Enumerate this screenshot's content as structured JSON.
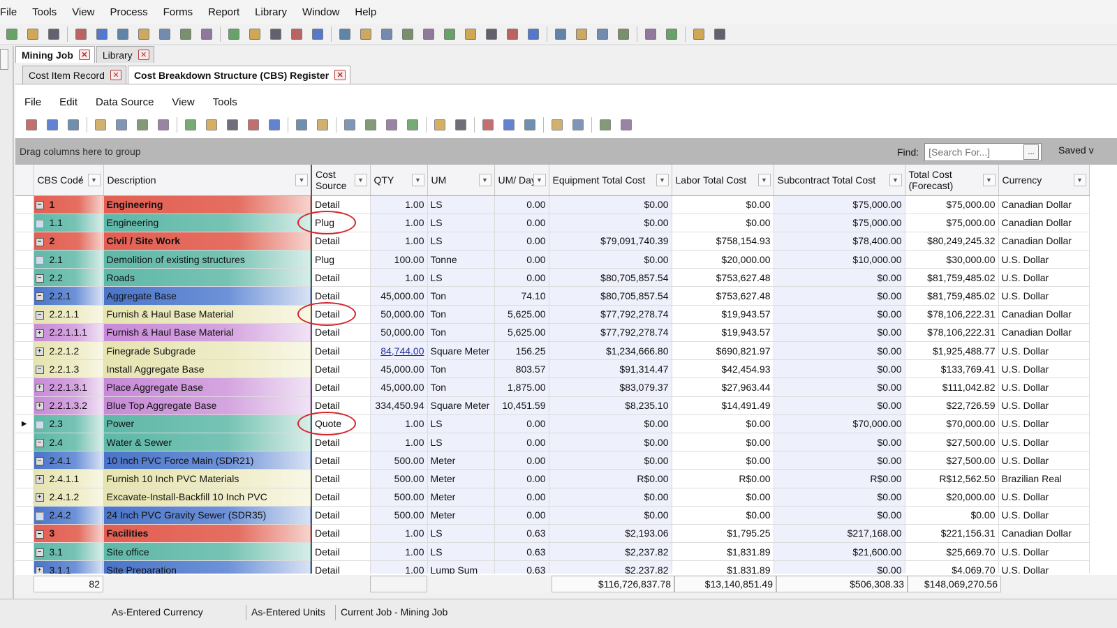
{
  "menu": [
    "File",
    "Tools",
    "View",
    "Process",
    "Forms",
    "Report",
    "Library",
    "Window",
    "Help"
  ],
  "toolbar_icons": [
    "new-icon",
    "open-icon",
    "save-icon",
    "delete-icon",
    "triangle-icon",
    "copy-icon",
    "folder-icon",
    "user-edit-icon",
    "hierarchy-icon",
    "group-icon",
    "document-icon",
    "print-icon",
    "mail-icon",
    "comment-icon",
    "approve-icon",
    "filter-icon",
    "chart-icon",
    "export-icon",
    "clipboard-icon",
    "target-icon",
    "crosshair-icon",
    "money-icon",
    "gear-icon",
    "disabled-icon",
    "bar-chart-icon",
    "pie-icon",
    "book-icon",
    "excel-icon",
    "paperclip-icon",
    "add-icon",
    "calculator-icon",
    "person-icon",
    "help-icon"
  ],
  "tabs1": [
    {
      "label": "Mining Job",
      "active": true
    },
    {
      "label": "Library",
      "active": false
    }
  ],
  "tabs2": [
    {
      "label": "Cost Item Record",
      "active": false
    },
    {
      "label": "Cost Breakdown Structure (CBS) Register",
      "active": true
    }
  ],
  "inner_menu": [
    "File",
    "Edit",
    "Data Source",
    "View",
    "Tools"
  ],
  "group_hint": "Drag columns here to group",
  "find": {
    "label": "Find:",
    "placeholder": "[Search For...]",
    "ellipsis": "...",
    "saved": "Saved v"
  },
  "columns": [
    {
      "key": "code",
      "label": "CBS Code",
      "sort": "/"
    },
    {
      "key": "desc",
      "label": "Description"
    },
    {
      "key": "src",
      "label": "Cost Source"
    },
    {
      "key": "qty",
      "label": "QTY"
    },
    {
      "key": "um",
      "label": "UM"
    },
    {
      "key": "umday",
      "label": "UM/ Day"
    },
    {
      "key": "equip",
      "label": "Equipment Total Cost"
    },
    {
      "key": "labor",
      "label": "Labor Total Cost"
    },
    {
      "key": "sub",
      "label": "Subcontract Total Cost"
    },
    {
      "key": "total",
      "label": "Total Cost (Forecast)"
    },
    {
      "key": "cur",
      "label": "Currency"
    }
  ],
  "rows": [
    {
      "lvl": 1,
      "tg": "−",
      "code": "1",
      "desc": "Engineering",
      "src": "Detail",
      "qty": "1.00",
      "um": "LS",
      "umday": "0.00",
      "equip": "$0.00",
      "labor": "$0.00",
      "sub": "$75,000.00",
      "total": "$75,000.00",
      "cur": "Canadian Dollar"
    },
    {
      "lvl": 2,
      "tg": "",
      "code": "1.1",
      "desc": "Engineering",
      "src": "Plug",
      "qty": "1.00",
      "um": "LS",
      "umday": "0.00",
      "equip": "$0.00",
      "labor": "$0.00",
      "sub": "$75,000.00",
      "total": "$75,000.00",
      "cur": "Canadian Dollar",
      "circled": true
    },
    {
      "lvl": 1,
      "tg": "−",
      "code": "2",
      "desc": "Civil / Site Work",
      "src": "Detail",
      "qty": "1.00",
      "um": "LS",
      "umday": "0.00",
      "equip": "$79,091,740.39",
      "labor": "$758,154.93",
      "sub": "$78,400.00",
      "total": "$80,249,245.32",
      "cur": "Canadian Dollar"
    },
    {
      "lvl": 2,
      "tg": "",
      "code": "2.1",
      "desc": "Demolition of existing structures",
      "src": "Plug",
      "qty": "100.00",
      "um": "Tonne",
      "umday": "0.00",
      "equip": "$0.00",
      "labor": "$20,000.00",
      "sub": "$10,000.00",
      "total": "$30,000.00",
      "cur": "U.S. Dollar"
    },
    {
      "lvl": 2,
      "tg": "−",
      "code": "2.2",
      "desc": "Roads",
      "src": "Detail",
      "qty": "1.00",
      "um": "LS",
      "umday": "0.00",
      "equip": "$80,705,857.54",
      "labor": "$753,627.48",
      "sub": "$0.00",
      "total": "$81,759,485.02",
      "cur": "U.S. Dollar"
    },
    {
      "lvl": 3,
      "tg": "−",
      "code": "2.2.1",
      "desc": "Aggregate Base",
      "src": "Detail",
      "qty": "45,000.00",
      "um": "Ton",
      "umday": "74.10",
      "equip": "$80,705,857.54",
      "labor": "$753,627.48",
      "sub": "$0.00",
      "total": "$81,759,485.02",
      "cur": "U.S. Dollar"
    },
    {
      "lvl": 4,
      "tg": "−",
      "code": "2.2.1.1",
      "desc": "Furnish & Haul Base Material",
      "src": "Detail",
      "qty": "50,000.00",
      "um": "Ton",
      "umday": "5,625.00",
      "equip": "$77,792,278.74",
      "labor": "$19,943.57",
      "sub": "$0.00",
      "total": "$78,106,222.31",
      "cur": "Canadian Dollar",
      "circled": true
    },
    {
      "lvl": 5,
      "tg": "+",
      "code": "2.2.1.1.1",
      "desc": "Furnish & Haul Base Material",
      "src": "Detail",
      "qty": "50,000.00",
      "um": "Ton",
      "umday": "5,625.00",
      "equip": "$77,792,278.74",
      "labor": "$19,943.57",
      "sub": "$0.00",
      "total": "$78,106,222.31",
      "cur": "Canadian Dollar"
    },
    {
      "lvl": 4,
      "tg": "+",
      "code": "2.2.1.2",
      "desc": "Finegrade Subgrade",
      "src": "Detail",
      "qty": "84,744.00",
      "qtylink": true,
      "um": "Square Meter",
      "umday": "156.25",
      "equip": "$1,234,666.80",
      "labor": "$690,821.97",
      "sub": "$0.00",
      "total": "$1,925,488.77",
      "cur": "U.S. Dollar"
    },
    {
      "lvl": 4,
      "tg": "−",
      "code": "2.2.1.3",
      "desc": "Install Aggregate Base",
      "src": "Detail",
      "qty": "45,000.00",
      "um": "Ton",
      "umday": "803.57",
      "equip": "$91,314.47",
      "labor": "$42,454.93",
      "sub": "$0.00",
      "total": "$133,769.41",
      "cur": "U.S. Dollar"
    },
    {
      "lvl": 5,
      "tg": "+",
      "code": "2.2.1.3.1",
      "desc": "Place Aggregate Base",
      "src": "Detail",
      "qty": "45,000.00",
      "um": "Ton",
      "umday": "1,875.00",
      "equip": "$83,079.37",
      "labor": "$27,963.44",
      "sub": "$0.00",
      "total": "$111,042.82",
      "cur": "U.S. Dollar"
    },
    {
      "lvl": 5,
      "tg": "+",
      "code": "2.2.1.3.2",
      "desc": "Blue Top Aggregate Base",
      "src": "Detail",
      "qty": "334,450.94",
      "um": "Square Meter",
      "umday": "10,451.59",
      "equip": "$8,235.10",
      "labor": "$14,491.49",
      "sub": "$0.00",
      "total": "$22,726.59",
      "cur": "U.S. Dollar"
    },
    {
      "lvl": 2,
      "tg": "",
      "code": "2.3",
      "desc": "Power",
      "src": "Quote",
      "qty": "1.00",
      "um": "LS",
      "umday": "0.00",
      "equip": "$0.00",
      "labor": "$0.00",
      "sub": "$70,000.00",
      "total": "$70,000.00",
      "cur": "U.S. Dollar",
      "circled": true,
      "current": true
    },
    {
      "lvl": 2,
      "tg": "−",
      "code": "2.4",
      "desc": "Water & Sewer",
      "src": "Detail",
      "qty": "1.00",
      "um": "LS",
      "umday": "0.00",
      "equip": "$0.00",
      "labor": "$0.00",
      "sub": "$0.00",
      "total": "$27,500.00",
      "cur": "U.S. Dollar"
    },
    {
      "lvl": 3,
      "tg": "−",
      "code": "2.4.1",
      "desc": "10 Inch PVC Force Main (SDR21)",
      "src": "Detail",
      "qty": "500.00",
      "um": "Meter",
      "umday": "0.00",
      "equip": "$0.00",
      "labor": "$0.00",
      "sub": "$0.00",
      "total": "$27,500.00",
      "cur": "U.S. Dollar"
    },
    {
      "lvl": 4,
      "tg": "+",
      "code": "2.4.1.1",
      "desc": "Furnish 10 Inch PVC Materials",
      "src": "Detail",
      "qty": "500.00",
      "um": "Meter",
      "umday": "0.00",
      "equip": "R$0.00",
      "labor": "R$0.00",
      "sub": "R$0.00",
      "total": "R$12,562.50",
      "cur": "Brazilian Real"
    },
    {
      "lvl": 4,
      "tg": "+",
      "code": "2.4.1.2",
      "desc": "Excavate-Install-Backfill 10 Inch PVC",
      "src": "Detail",
      "qty": "500.00",
      "um": "Meter",
      "umday": "0.00",
      "equip": "$0.00",
      "labor": "$0.00",
      "sub": "$0.00",
      "total": "$20,000.00",
      "cur": "U.S. Dollar"
    },
    {
      "lvl": 3,
      "tg": "",
      "code": "2.4.2",
      "desc": "24 Inch PVC Gravity Sewer (SDR35)",
      "src": "Detail",
      "qty": "500.00",
      "um": "Meter",
      "umday": "0.00",
      "equip": "$0.00",
      "labor": "$0.00",
      "sub": "$0.00",
      "total": "$0.00",
      "cur": "U.S. Dollar"
    },
    {
      "lvl": 1,
      "tg": "−",
      "code": "3",
      "desc": "Facilities",
      "src": "Detail",
      "qty": "1.00",
      "um": "LS",
      "umday": "0.63",
      "equip": "$2,193.06",
      "labor": "$1,795.25",
      "sub": "$217,168.00",
      "total": "$221,156.31",
      "cur": "Canadian Dollar"
    },
    {
      "lvl": 2,
      "tg": "−",
      "code": "3.1",
      "desc": "Site office",
      "src": "Detail",
      "qty": "1.00",
      "um": "LS",
      "umday": "0.63",
      "equip": "$2,237.82",
      "labor": "$1,831.89",
      "sub": "$21,600.00",
      "total": "$25,669.70",
      "cur": "U.S. Dollar"
    },
    {
      "lvl": 3,
      "tg": "+",
      "code": "3.1.1",
      "desc": "Site Preparation",
      "src": "Detail",
      "qty": "1.00",
      "um": "Lump Sum",
      "umday": "0.63",
      "equip": "$2,237.82",
      "labor": "$1,831.89",
      "sub": "$0.00",
      "total": "$4,069.70",
      "cur": "U.S. Dollar"
    }
  ],
  "totals": {
    "count": "82",
    "equip": "$116,726,837.78",
    "labor": "$13,140,851.49",
    "sub": "$506,308.33",
    "total": "$148,069,270.56"
  },
  "status": {
    "currency": "As-Entered Currency",
    "units": "As-Entered Units",
    "job": "Current Job - Mining Job"
  }
}
